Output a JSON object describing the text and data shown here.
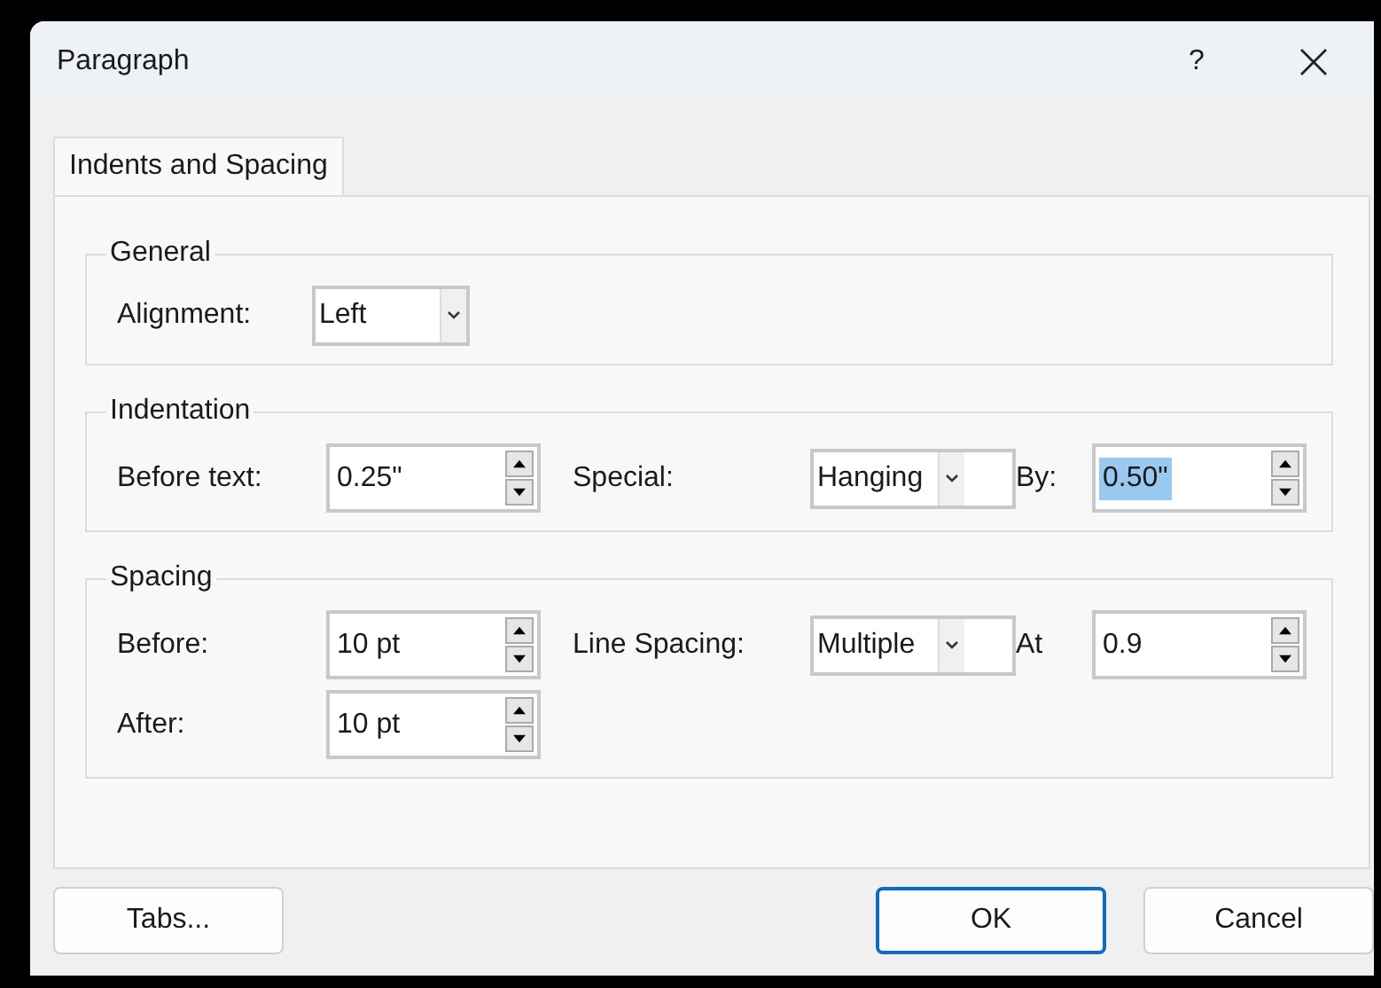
{
  "window": {
    "title": "Paragraph",
    "help": "?"
  },
  "tabs": [
    {
      "label": "Indents and Spacing",
      "selected": true
    }
  ],
  "groups": [
    {
      "title": "General",
      "rows": [
        [
          {
            "kind": "label",
            "text": "Alignment:"
          },
          {
            "kind": "dropdown",
            "value": "Left"
          }
        ]
      ]
    },
    {
      "title": "Indentation",
      "rows": [
        [
          {
            "kind": "label",
            "text": "Before text:"
          },
          {
            "kind": "spin",
            "value": "0.25\"",
            "selected": false
          },
          {
            "kind": "label",
            "text": "Special:"
          },
          {
            "kind": "dropdown",
            "value": "Hanging"
          },
          {
            "kind": "label",
            "text": "By:"
          },
          {
            "kind": "spin",
            "value": "0.50\"",
            "selected": true
          }
        ]
      ]
    },
    {
      "title": "Spacing",
      "rows": [
        [
          {
            "kind": "label",
            "text": "Before:"
          },
          {
            "kind": "spin",
            "value": "10 pt",
            "selected": false
          },
          {
            "kind": "label",
            "text": "Line Spacing:"
          },
          {
            "kind": "dropdown",
            "value": "Multiple"
          },
          {
            "kind": "label",
            "text": "At"
          },
          {
            "kind": "spin",
            "value": "0.9",
            "selected": false
          }
        ],
        [
          {
            "kind": "label",
            "text": "After:"
          },
          {
            "kind": "spin",
            "value": "10 pt",
            "selected": false
          }
        ]
      ]
    }
  ],
  "buttons": [
    {
      "label": "Tabs...",
      "default": false
    },
    {
      "label": "OK",
      "default": true
    },
    {
      "label": "Cancel",
      "default": false
    }
  ]
}
